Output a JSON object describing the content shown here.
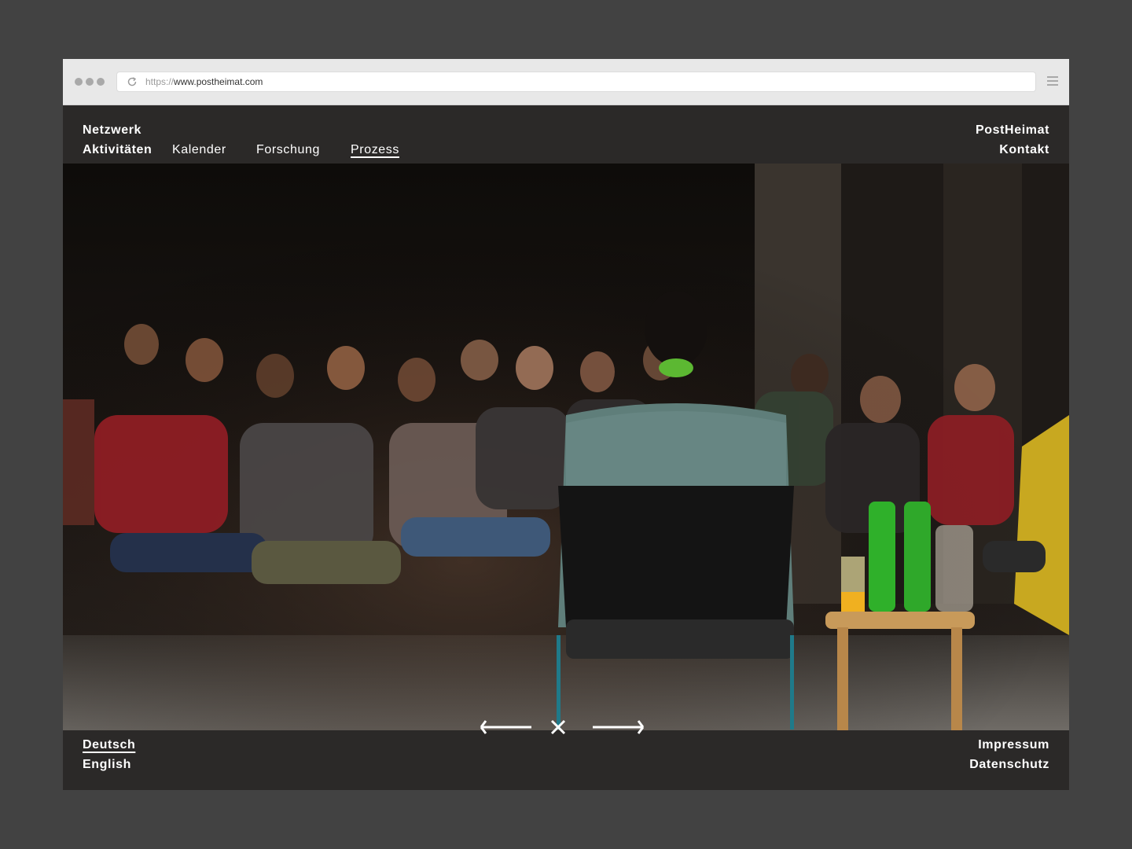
{
  "browser": {
    "url_protocol": "https://",
    "url_host": "www.postheimat.com",
    "reload_icon": "reload-icon",
    "menu_icon": "hamburger-menu-icon"
  },
  "nav": {
    "netzwerk": "Netzwerk",
    "aktivitaeten": "Aktivitäten",
    "kalender": "Kalender",
    "forschung": "Forschung",
    "prozess": "Prozess",
    "postheimat": "PostHeimat",
    "kontakt": "Kontakt"
  },
  "gallery": {
    "prev_icon": "arrow-left-icon",
    "close_icon": "close-icon",
    "next_icon": "arrow-right-icon"
  },
  "footer": {
    "deutsch": "Deutsch",
    "english": "English",
    "impressum": "Impressum",
    "datenschutz": "Datenschutz"
  },
  "colors": {
    "page_background": "#424242",
    "site_background": "#2b2928",
    "text": "#ffffff",
    "browser_chrome": "#e8e8e8"
  }
}
